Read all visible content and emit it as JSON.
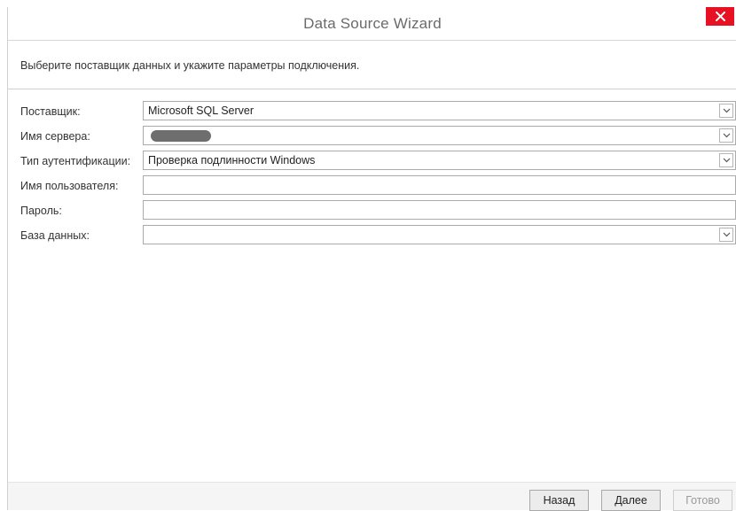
{
  "window": {
    "title": "Data Source Wizard",
    "close_icon": "close-icon"
  },
  "instruction": "Выберите поставщик данных и укажите параметры подключения.",
  "form": {
    "provider": {
      "label": "Поставщик:",
      "value": "Microsoft SQL Server"
    },
    "server": {
      "label": "Имя сервера:",
      "value": ""
    },
    "auth": {
      "label": "Тип аутентификации:",
      "value": "Проверка подлинности Windows"
    },
    "username": {
      "label": "Имя пользователя:",
      "value": ""
    },
    "password": {
      "label": "Пароль:",
      "value": ""
    },
    "database": {
      "label": "База данных:",
      "value": ""
    }
  },
  "buttons": {
    "back": "Назад",
    "next": "Далее",
    "finish": "Готово"
  },
  "colors": {
    "close_bg": "#e81123",
    "title_text": "#6b6b6b"
  }
}
